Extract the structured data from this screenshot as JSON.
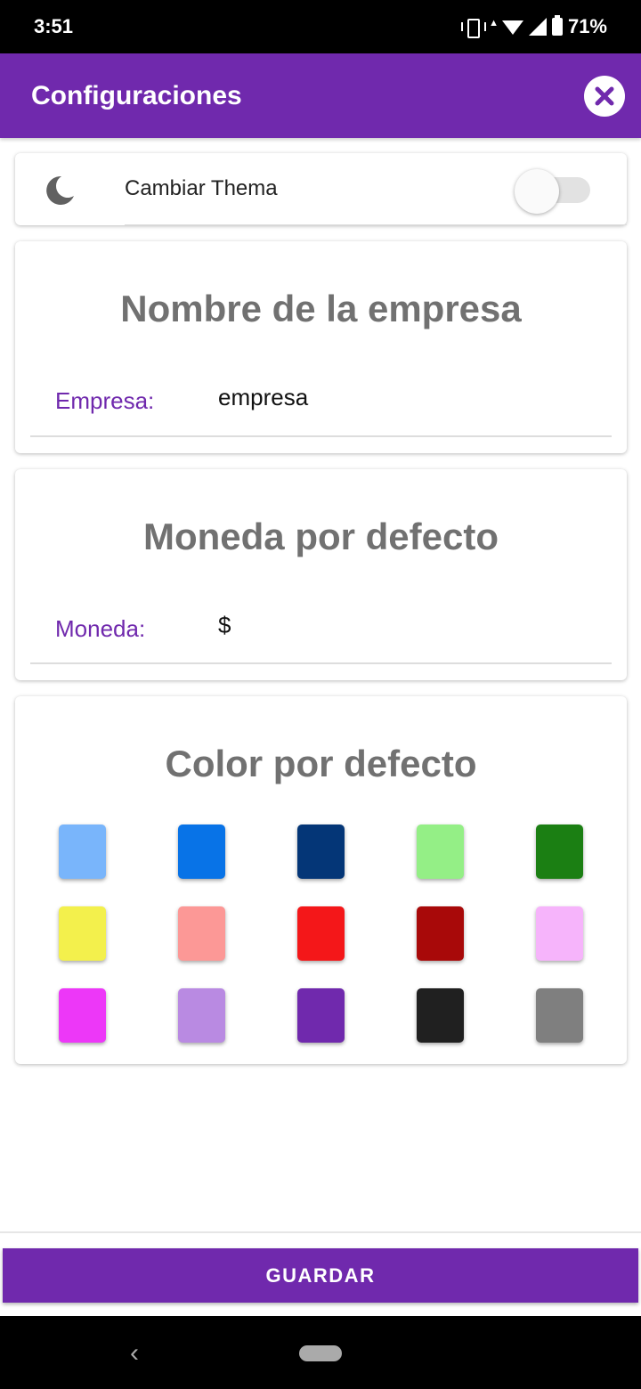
{
  "status_bar": {
    "time": "3:51",
    "battery": "71%"
  },
  "app_bar": {
    "title": "Configuraciones"
  },
  "theme": {
    "label": "Cambiar Thema",
    "enabled": false
  },
  "company": {
    "title": "Nombre de la empresa",
    "label": "Empresa:",
    "value": "empresa"
  },
  "currency": {
    "title": "Moneda por defecto",
    "label": "Moneda:",
    "value": "$"
  },
  "colors": {
    "title": "Color por defecto",
    "swatches": [
      "#79b5fb",
      "#0873e7",
      "#043677",
      "#94ef86",
      "#1b7f13",
      "#f3f04c",
      "#fc9896",
      "#f41719",
      "#a80909",
      "#f6b4fb",
      "#ed37f8",
      "#b98ae2",
      "#7029ad",
      "#202020",
      "#7f7f7f"
    ]
  },
  "save_button": {
    "label": "GUARDAR"
  },
  "accent_color": "#7029ad"
}
